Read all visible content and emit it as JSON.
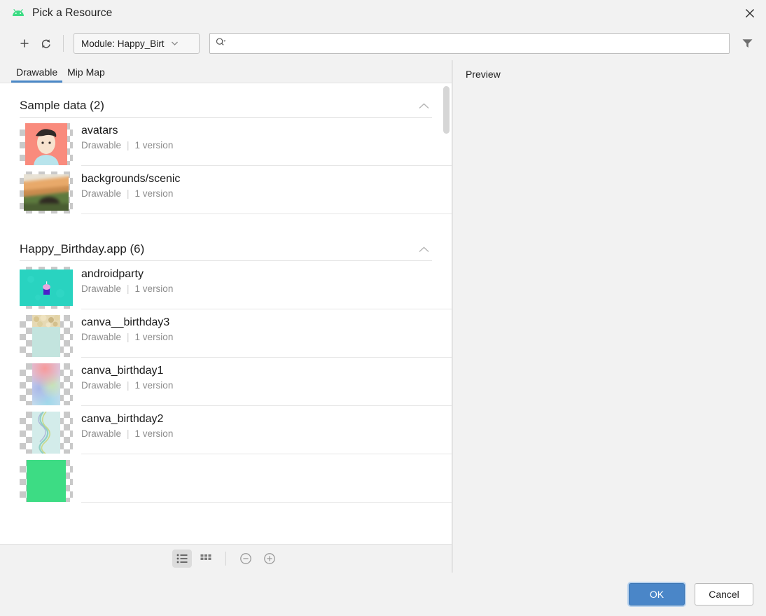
{
  "window": {
    "title": "Pick a Resource",
    "app_icon": "android-icon",
    "close_label": "✕"
  },
  "toolbar": {
    "add_label": "+",
    "refresh_label": "refresh-icon",
    "module_label": "Module: Happy_Birt",
    "module_caret": "▼",
    "search_placeholder": "",
    "search_value": "",
    "search_icon": "search-icon",
    "filter_icon": "filter-icon"
  },
  "tabs": [
    {
      "label": "Drawable",
      "active": true
    },
    {
      "label": "Mip Map",
      "active": false
    }
  ],
  "preview": {
    "title": "Preview"
  },
  "groups": [
    {
      "title": "Sample data (2)",
      "count": 2,
      "expanded": true,
      "chevron": "chevron-up-icon",
      "items": [
        {
          "name": "avatars",
          "type": "Drawable",
          "versions": "1 version",
          "thumb": "avatar-face"
        },
        {
          "name": "backgrounds/scenic",
          "type": "Drawable",
          "versions": "1 version",
          "thumb": "scenic-photo"
        }
      ]
    },
    {
      "title": "Happy_Birthday.app (6)",
      "count": 6,
      "expanded": true,
      "chevron": "chevron-up-icon",
      "items": [
        {
          "name": "androidparty",
          "type": "Drawable",
          "versions": "1 version",
          "thumb": "teal-cupcake"
        },
        {
          "name": "canva__birthday3",
          "type": "Drawable",
          "versions": "1 version",
          "thumb": "confetti-mint"
        },
        {
          "name": "canva_birthday1",
          "type": "Drawable",
          "versions": "1 version",
          "thumb": "pastel-gradient"
        },
        {
          "name": "canva_birthday2",
          "type": "Drawable",
          "versions": "1 version",
          "thumb": "wavy-mint"
        },
        {
          "name": "",
          "type": "",
          "versions": "",
          "thumb": "green-block"
        }
      ]
    }
  ],
  "view_toolbar": {
    "list_view": "list-view-icon",
    "grid_view": "grid-view-icon",
    "zoom_out": "zoom-out-icon",
    "zoom_in": "zoom-in-icon"
  },
  "footer": {
    "ok_label": "OK",
    "cancel_label": "Cancel"
  },
  "colors": {
    "accent": "#4a86c8",
    "tab_underline": "#4a88c7",
    "list_bg": "#ffffff",
    "chrome_bg": "#f2f2f2"
  }
}
